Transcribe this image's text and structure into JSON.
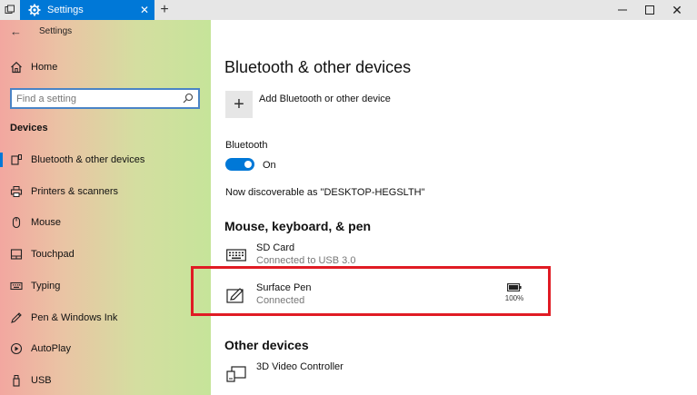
{
  "titlebar": {
    "tab_label": "Settings",
    "close_tab": "✕",
    "new_tab": "+",
    "minimize": "—",
    "maximize": "□",
    "close_window": "✕"
  },
  "sidebar": {
    "back": "←",
    "app_title": "Settings",
    "home_label": "Home",
    "search_placeholder": "Find a setting",
    "section": "Devices",
    "items": [
      {
        "label": "Bluetooth & other devices",
        "icon": "bluetooth-icon",
        "selected": true
      },
      {
        "label": "Printers & scanners",
        "icon": "printer-icon"
      },
      {
        "label": "Mouse",
        "icon": "mouse-icon"
      },
      {
        "label": "Touchpad",
        "icon": "touchpad-icon"
      },
      {
        "label": "Typing",
        "icon": "keyboard-icon"
      },
      {
        "label": "Pen & Windows Ink",
        "icon": "pen-icon"
      },
      {
        "label": "AutoPlay",
        "icon": "autoplay-icon"
      },
      {
        "label": "USB",
        "icon": "usb-icon"
      }
    ]
  },
  "main": {
    "title": "Bluetooth & other devices",
    "add_plus": "+",
    "add_label": "Add Bluetooth or other device",
    "bluetooth_label": "Bluetooth",
    "toggle_state": "On",
    "discoverable": "Now discoverable as \"DESKTOP-HEGSLTH\"",
    "mkp_heading": "Mouse, keyboard, & pen",
    "devices": [
      {
        "name": "SD Card",
        "status": "Connected to USB 3.0",
        "icon": "keyboard-icon"
      },
      {
        "name": "Surface Pen",
        "status": "Connected",
        "icon": "pen-icon",
        "battery": "100%"
      }
    ],
    "other_heading": "Other devices",
    "other_devices": [
      {
        "name": "3D Video Controller",
        "icon": "display-device-icon"
      }
    ]
  },
  "colors": {
    "accent": "#0078d7",
    "highlight": "#e01b24"
  }
}
